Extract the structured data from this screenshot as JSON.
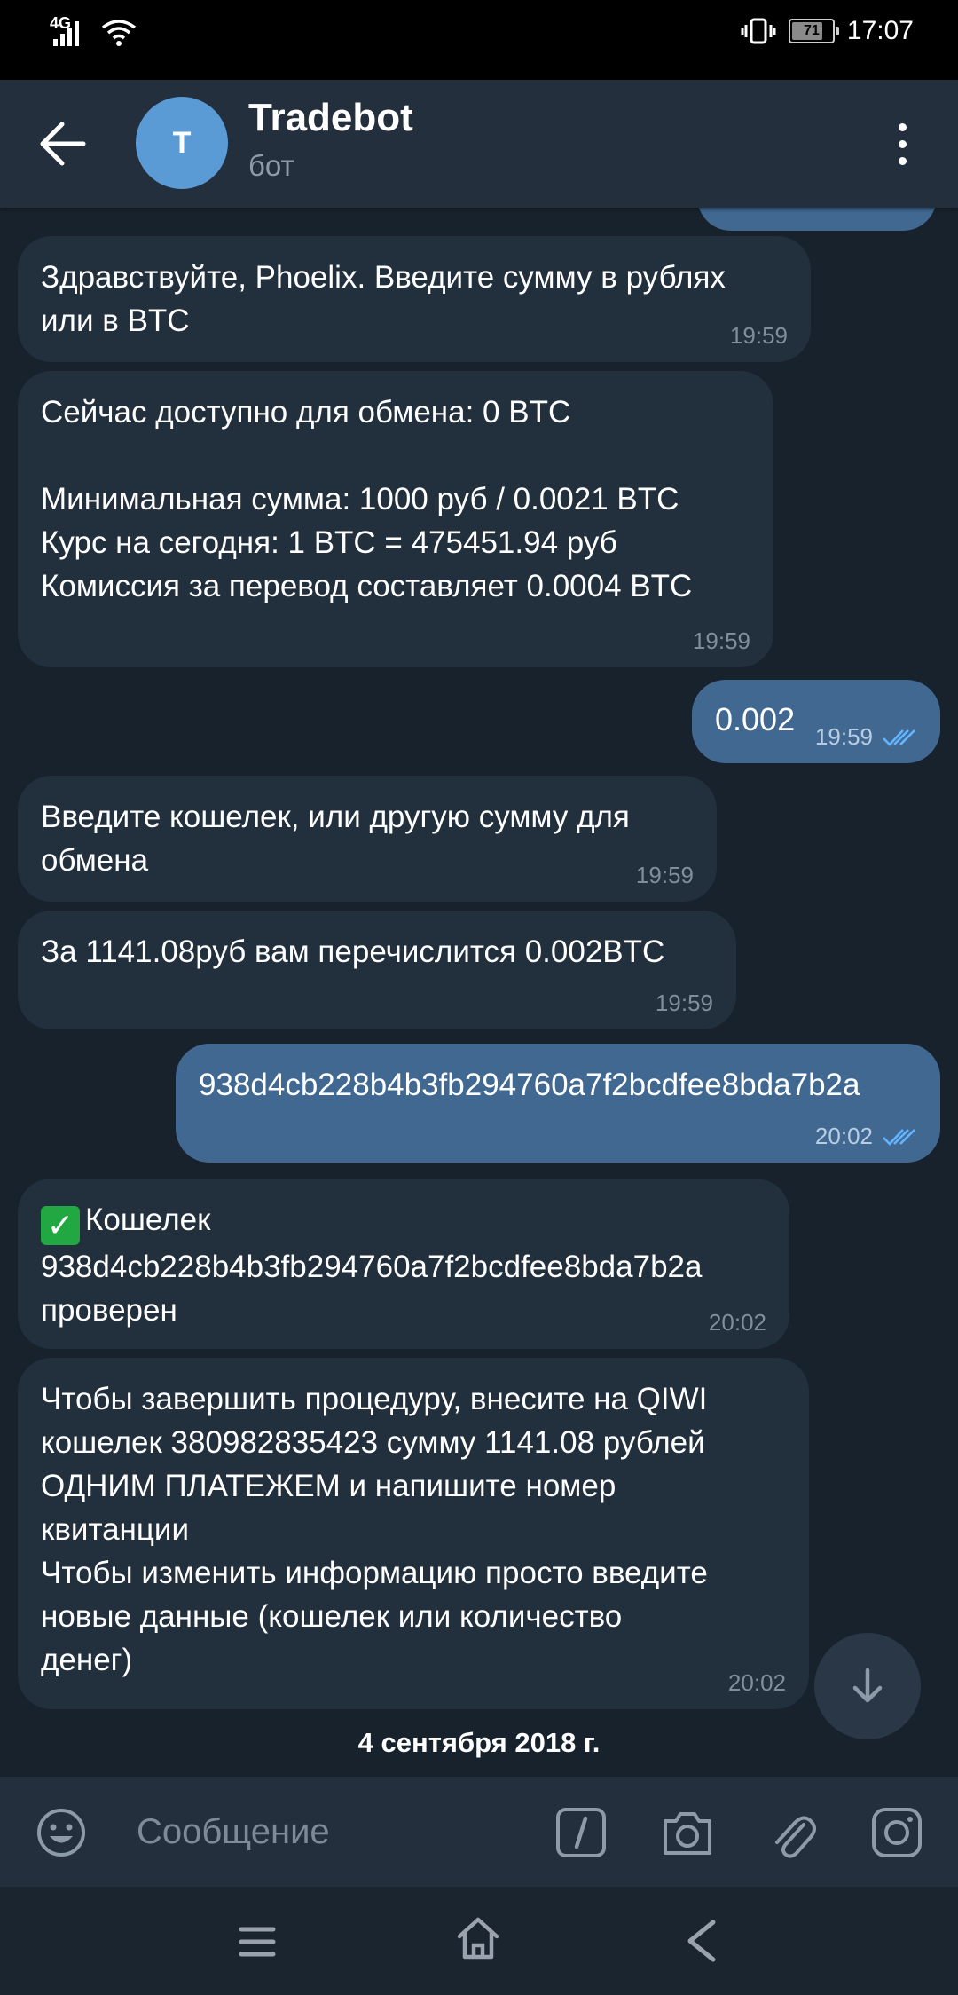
{
  "status_bar": {
    "network": "4G",
    "battery": "71",
    "time": "17:07"
  },
  "header": {
    "avatar_letter": "T",
    "title": "Tradebot",
    "subtitle": "бот"
  },
  "messages": [
    {
      "dir": "in",
      "text": "Здравствуйте, Phoelix. Введите сумму в рублях\nили в BTC",
      "time": "19:59"
    },
    {
      "dir": "in",
      "text": "Сейчас доступно для обмена: 0 BTC\n\nМинимальная сумма: 1000 руб / 0.0021 BTC\nКурс на сегодня: 1 BTC = 475451.94 руб\nКомиссия за перевод составляет 0.0004 BTC",
      "time": "19:59"
    },
    {
      "dir": "out",
      "text": "0.002",
      "time": "19:59"
    },
    {
      "dir": "in",
      "text": "Введите кошелек, или другую сумму для\nобмена",
      "time": "19:59"
    },
    {
      "dir": "in",
      "text": "За 1141.08руб вам перечислится 0.002BTC",
      "time": "19:59"
    },
    {
      "dir": "out",
      "text": "938d4cb228b4b3fb294760a7f2bcdfee8bda7b2a",
      "time": "20:02"
    },
    {
      "dir": "in",
      "text_line1": "Кошелек",
      "text_rest": "938d4cb228b4b3fb294760a7f2bcdfee8bda7b2a\nпроверен",
      "time": "20:02"
    },
    {
      "dir": "in",
      "text": "Чтобы завершить процедуру, внесите на QIWI\nкошелек 380982835423 сумму 1141.08 рублей\nОДНИМ ПЛАТЕЖЕМ и напишите номер\nквитанции\nЧтобы изменить информацию просто введите\nновые данные (кошелек или количество\nденег)",
      "time": "20:02"
    }
  ],
  "date_separator": "4 сентября 2018 г.",
  "input": {
    "placeholder": "Сообщение"
  },
  "colors": {
    "background": "#18222d",
    "header": "#242f3d",
    "incoming_bubble": "#222f3d",
    "outgoing_bubble": "#406891",
    "avatar": "#5b9bd5",
    "read_checks": "#64b4ff"
  },
  "icons": [
    "back-arrow-icon",
    "more-vert-icon",
    "emoji-icon",
    "bot-command-icon",
    "camera-icon",
    "attach-icon",
    "instagram-icon",
    "arrow-down-icon",
    "double-check-icon",
    "check-mark-emoji",
    "nav-menu-icon",
    "nav-home-icon",
    "nav-back-icon"
  ]
}
